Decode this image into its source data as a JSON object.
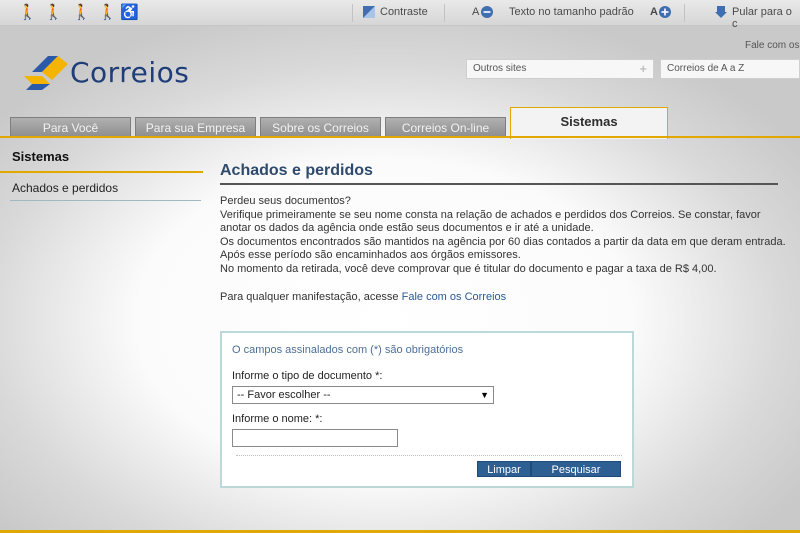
{
  "topbar": {
    "contrast_label": "Contraste",
    "text_size_small": "A",
    "text_size_default": "Texto no tamanho padrão",
    "text_size_large": "A",
    "skip_label": "Pular para o c"
  },
  "header": {
    "logo_text": "Correios",
    "contact_link": "Fale com os",
    "select_other_sites": "Outros sites",
    "select_correios_az": "Correios de A a Z"
  },
  "tabs": [
    {
      "label": "Para Você"
    },
    {
      "label": "Para sua Empresa"
    },
    {
      "label": "Sobre os Correios"
    },
    {
      "label": "Correios On-line"
    },
    {
      "label": "Sistemas"
    }
  ],
  "sidebar": {
    "title": "Sistemas",
    "items": [
      {
        "label": "Achados e perdidos"
      }
    ]
  },
  "main": {
    "title": "Achados e perdidos",
    "paragraph_lines": [
      "Perdeu seus documentos?",
      "Verifique primeiramente se seu nome consta na relação de achados e perdidos dos Correios. Se constar, favor",
      "anotar os dados da agência onde estão seus documentos e ir até a unidade.",
      "Os documentos encontrados são mantidos na agência por 60 dias contados a partir da data em que deram entrada.",
      "Após esse período são encaminhados aos órgãos emissores.",
      "No momento da retirada, você deve comprovar que é titular do documento e pagar a taxa de R$ 4,00."
    ],
    "contact_prefix": "Para qualquer manifestação, acesse ",
    "contact_link": "Fale com os Correios"
  },
  "form": {
    "required_note": "O campos assinalados com (*) são obrigatórios",
    "doc_type_label": "Informe o tipo de documento *:",
    "doc_type_selected": "-- Favor escolher --",
    "name_label": "Informe o nome: *:",
    "name_value": "",
    "clear_button": "Limpar",
    "search_button": "Pesquisar"
  },
  "colors": {
    "accent_yellow": "#e0a800",
    "brand_blue": "#1f3d78",
    "button_blue": "#2d5f93"
  }
}
